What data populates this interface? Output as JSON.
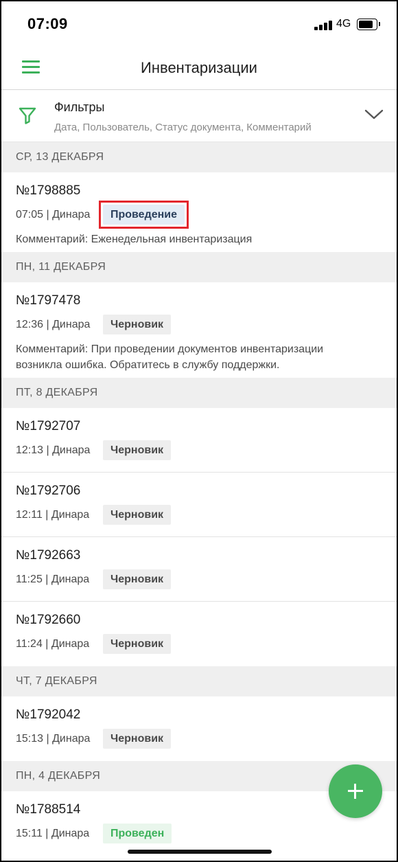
{
  "status_bar": {
    "time": "07:09",
    "network": "4G"
  },
  "header": {
    "title": "Инвентаризации"
  },
  "filters": {
    "title": "Фильтры",
    "summary": "Дата, Пользователь, Статус документа, Комментарий"
  },
  "sections": [
    {
      "date": "СР, 13 ДЕКАБРЯ",
      "docs": [
        {
          "number": "№1798885",
          "meta": "07:05 | Динара",
          "status": "Проведение",
          "status_type": "process",
          "comment": "Комментарий: Еженедельная инвентаризация"
        }
      ]
    },
    {
      "date": "ПН, 11 ДЕКАБРЯ",
      "docs": [
        {
          "number": "№1797478",
          "meta": "12:36 | Динара",
          "status": "Черновик",
          "status_type": "draft",
          "comment": "Комментарий: При проведении документов инвентаризации возникла ошибка. Обратитесь в службу поддержки."
        }
      ]
    },
    {
      "date": "ПТ, 8 ДЕКАБРЯ",
      "docs": [
        {
          "number": "№1792707",
          "meta": "12:13 | Динара",
          "status": "Черновик",
          "status_type": "draft"
        },
        {
          "number": "№1792706",
          "meta": "12:11 | Динара",
          "status": "Черновик",
          "status_type": "draft"
        },
        {
          "number": "№1792663",
          "meta": "11:25 | Динара",
          "status": "Черновик",
          "status_type": "draft"
        },
        {
          "number": "№1792660",
          "meta": "11:24 | Динара",
          "status": "Черновик",
          "status_type": "draft"
        }
      ]
    },
    {
      "date": "ЧТ, 7 ДЕКАБРЯ",
      "docs": [
        {
          "number": "№1792042",
          "meta": "15:13 | Динара",
          "status": "Черновик",
          "status_type": "draft"
        }
      ]
    },
    {
      "date": "ПН, 4 ДЕКАБРЯ",
      "docs": [
        {
          "number": "№1788514",
          "meta": "15:11 | Динара",
          "status": "Проведен",
          "status_type": "done"
        }
      ]
    }
  ],
  "colors": {
    "accent": "#3cb15a",
    "highlight": "#e3262d"
  },
  "icons": {
    "menu": "hamburger-menu-icon",
    "filter": "funnel-icon",
    "expand": "chevron-down-icon",
    "add": "plus-icon"
  }
}
